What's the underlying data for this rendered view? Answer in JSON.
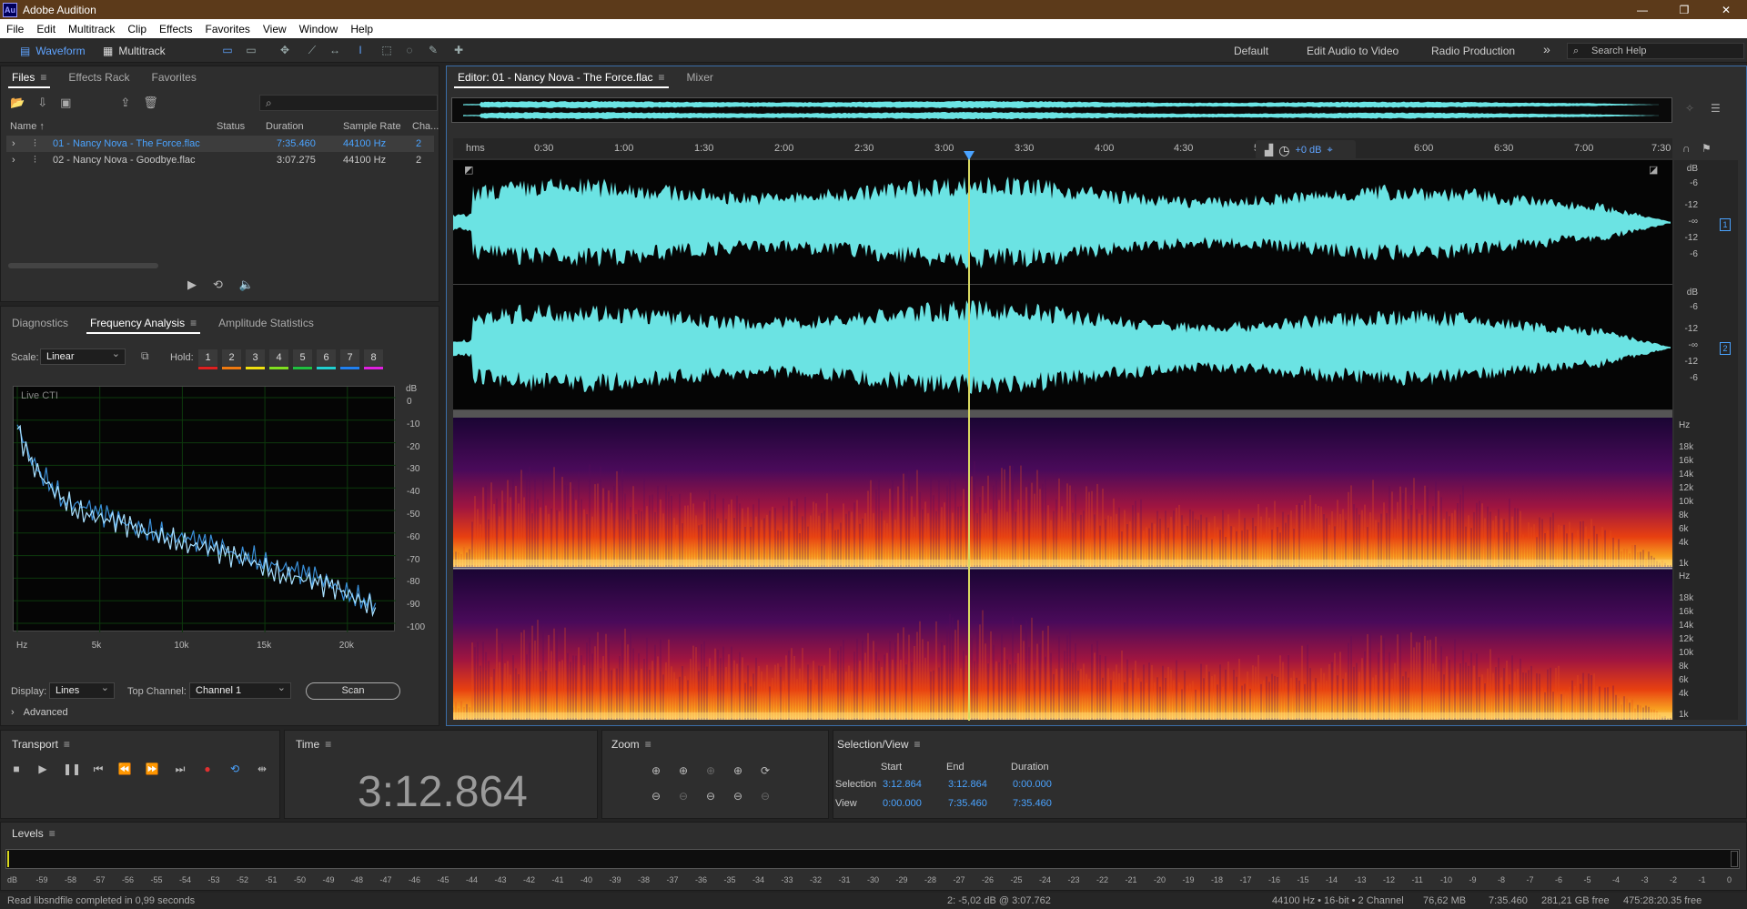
{
  "app": {
    "title": "Adobe Audition",
    "logo_text": "Au"
  },
  "menu": [
    "File",
    "Edit",
    "Multitrack",
    "Clip",
    "Effects",
    "Favorites",
    "View",
    "Window",
    "Help"
  ],
  "toolbar": {
    "waveform_label": "Waveform",
    "multitrack_label": "Multitrack",
    "workspaces": [
      "Default",
      "Edit Audio to Video",
      "Radio Production"
    ],
    "more": "»",
    "search_placeholder": "Search Help"
  },
  "files_panel": {
    "tabs": [
      "Files",
      "Effects Rack",
      "Favorites"
    ],
    "columns": [
      "Name ↑",
      "Status",
      "Duration",
      "Sample Rate",
      "Cha..."
    ],
    "files": [
      {
        "name": "01 - Nancy Nova - The Force.flac",
        "status": "",
        "duration": "7:35.460",
        "rate": "44100 Hz",
        "ch": "2"
      },
      {
        "name": "02 - Nancy Nova - Goodbye.flac",
        "status": "",
        "duration": "3:07.275",
        "rate": "44100 Hz",
        "ch": "2"
      }
    ]
  },
  "analysis_panel": {
    "tabs": [
      "Diagnostics",
      "Frequency Analysis",
      "Amplitude Statistics"
    ],
    "scale_label": "Scale:",
    "scale_value": "Linear",
    "hold_label": "Hold:",
    "hold": [
      {
        "n": "1",
        "color": "#e02020"
      },
      {
        "n": "2",
        "color": "#f07a10"
      },
      {
        "n": "3",
        "color": "#f0e010"
      },
      {
        "n": "4",
        "color": "#80e020"
      },
      {
        "n": "5",
        "color": "#20c040"
      },
      {
        "n": "6",
        "color": "#20d0d0"
      },
      {
        "n": "7",
        "color": "#2080f0"
      },
      {
        "n": "8",
        "color": "#e020e0"
      }
    ],
    "graph_label": "Live CTI",
    "db_unit": "dB",
    "db_ticks": [
      "0",
      "-10",
      "-20",
      "-30",
      "-40",
      "-50",
      "-60",
      "-70",
      "-80",
      "-90",
      "-100"
    ],
    "hz_ticks": [
      "Hz",
      "5k",
      "10k",
      "15k",
      "20k"
    ],
    "display_label": "Display:",
    "display_value": "Lines",
    "top_channel_label": "Top Channel:",
    "top_channel_value": "Channel 1",
    "scan_label": "Scan",
    "advanced_label": "Advanced"
  },
  "chart_data": {
    "type": "line",
    "title": "",
    "xlabel": "",
    "ylabel": "",
    "x_unit": "Hz",
    "y_unit": "dB",
    "xlim": [
      0,
      22050
    ],
    "ylim": [
      -100,
      0
    ],
    "x": [
      0,
      700,
      1400,
      2100,
      2800,
      3500,
      4200,
      4900,
      5600,
      6300,
      7000,
      7700,
      8400,
      9100,
      9800,
      10500,
      11200,
      11900,
      12600,
      13300,
      14000,
      14700,
      15400,
      16100,
      16800,
      17500,
      18200,
      18900,
      19600,
      20300,
      21000,
      21700
    ],
    "series": [
      {
        "values": [
          -12,
          -25,
          -33,
          -38,
          -45,
          -47,
          -49,
          -52,
          -53,
          -55,
          -57,
          -58,
          -59,
          -60,
          -62,
          -63,
          -65,
          -66,
          -67,
          -70,
          -69,
          -72,
          -73,
          -76,
          -77,
          -79,
          -80,
          -82,
          -85,
          -87,
          -89,
          -91
        ],
        "color": "#3a8fd8"
      },
      {
        "values": [
          -14,
          -28,
          -35,
          -40,
          -44,
          -49,
          -51,
          -53,
          -55,
          -56,
          -58,
          -60,
          -60,
          -62,
          -63,
          -65,
          -66,
          -68,
          -70,
          -71,
          -72,
          -74,
          -76,
          -78,
          -79,
          -81,
          -83,
          -84,
          -86,
          -88,
          -90,
          -93
        ],
        "color": "#a8e0ff"
      }
    ],
    "grid": true
  },
  "editor": {
    "tabs": [
      "Editor: 01 - Nancy Nova - The Force.flac",
      "Mixer"
    ],
    "ruler": [
      "hms",
      "0:30",
      "1:00",
      "1:30",
      "2:00",
      "2:30",
      "3:00",
      "3:30",
      "4:00",
      "4:30",
      "5",
      "6:00",
      "6:30",
      "7:00",
      "7:30"
    ],
    "gain": "+0 dB",
    "db_ticks": [
      "dB",
      "-6",
      "-12",
      "-∞",
      "-12",
      "-6"
    ],
    "hz_ticks": [
      "Hz",
      "18k",
      "16k",
      "14k",
      "12k",
      "10k",
      "8k",
      "6k",
      "4k",
      "1k"
    ],
    "channels": [
      "1",
      "2"
    ],
    "waveform_color": "#6be3e3"
  },
  "transport": {
    "title": "Transport"
  },
  "time": {
    "title": "Time",
    "value": "3:12.864"
  },
  "zoom": {
    "title": "Zoom"
  },
  "selection": {
    "title": "Selection/View",
    "headers": [
      "Start",
      "End",
      "Duration"
    ],
    "rows": [
      {
        "label": "Selection",
        "start": "3:12.864",
        "end": "3:12.864",
        "duration": "0:00.000"
      },
      {
        "label": "View",
        "start": "0:00.000",
        "end": "7:35.460",
        "duration": "7:35.460"
      }
    ]
  },
  "levels": {
    "title": "Levels",
    "ticks": [
      "dB",
      "-59",
      "-58",
      "-57",
      "-56",
      "-55",
      "-54",
      "-53",
      "-52",
      "-51",
      "-50",
      "-49",
      "-48",
      "-47",
      "-46",
      "-45",
      "-44",
      "-43",
      "-42",
      "-41",
      "-40",
      "-39",
      "-38",
      "-37",
      "-36",
      "-35",
      "-34",
      "-33",
      "-32",
      "-31",
      "-30",
      "-29",
      "-28",
      "-27",
      "-26",
      "-25",
      "-24",
      "-23",
      "-22",
      "-21",
      "-20",
      "-19",
      "-18",
      "-17",
      "-16",
      "-15",
      "-14",
      "-13",
      "-12",
      "-11",
      "-10",
      "-9",
      "-8",
      "-7",
      "-6",
      "-5",
      "-4",
      "-3",
      "-2",
      "-1",
      "0"
    ]
  },
  "status": {
    "message": "Read libsndfile completed in 0,99 seconds",
    "cursor": "2: -5,02 dB @ 3:07.762",
    "format": "44100 Hz • 16-bit • 2 Channel",
    "size": "76,62 MB",
    "duration": "7:35.460",
    "free": "281,21 GB free",
    "free_time": "475:28:20.35 free"
  }
}
